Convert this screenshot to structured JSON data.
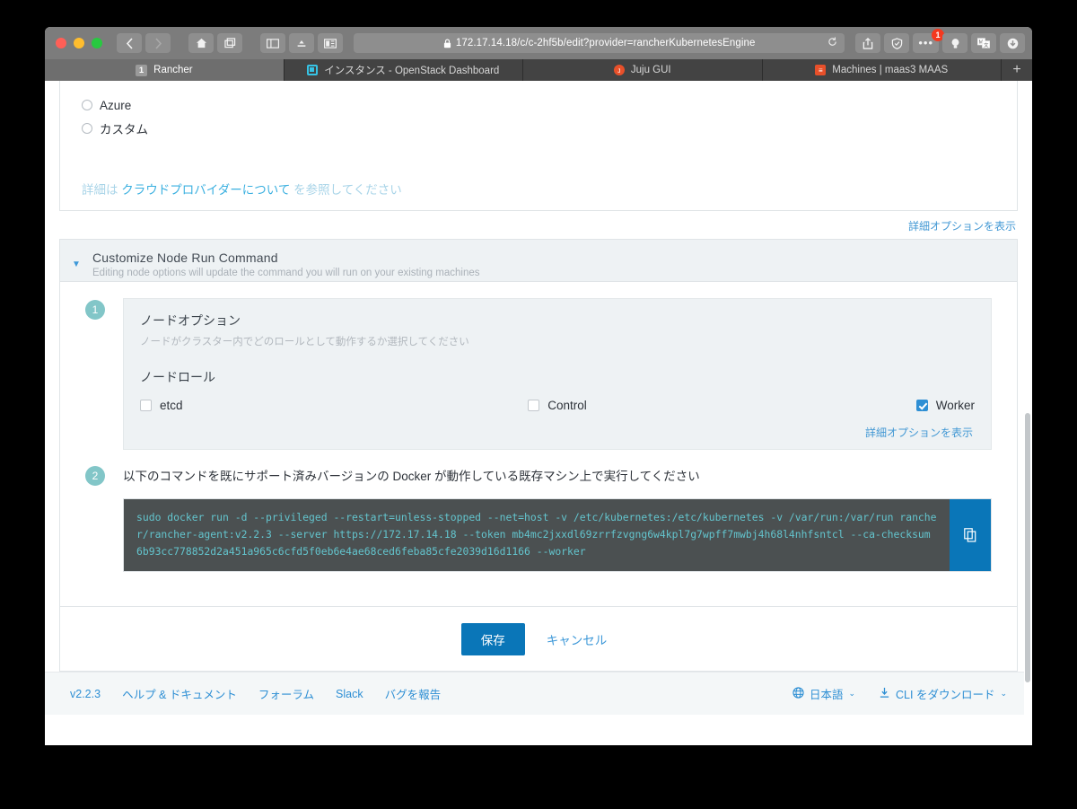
{
  "browser": {
    "url": "172.17.14.18/c/c-2hf5b/edit?provider=rancherKubernetesEngine",
    "nav": {
      "back": "‹",
      "forward": "›",
      "home": "home-icon",
      "tabs": "tabs-icon"
    },
    "extension_badge": "1",
    "tabs": [
      {
        "title": "Rancher",
        "badge": "1",
        "active": true,
        "favicon": "number-badge"
      },
      {
        "title": "インスタンス - OpenStack Dashboard",
        "active": false,
        "favicon": "openstack-icon"
      },
      {
        "title": "Juju GUI",
        "active": false,
        "favicon": "juju-icon"
      },
      {
        "title": "Machines | maas3 MAAS",
        "active": false,
        "favicon": "maas-icon"
      }
    ],
    "new_tab_label": "+"
  },
  "page": {
    "providers": [
      {
        "label": "Azure",
        "selected": false
      },
      {
        "label": "カスタム",
        "selected": false
      }
    ],
    "provider_help": {
      "prefix": "詳細は",
      "link": "クラウドプロバイダーについて",
      "suffix": "を参照してください"
    },
    "show_advanced_top": "詳細オプションを表示",
    "customize": {
      "title": "Customize Node Run Command",
      "subtitle": "Editing node options will update the command you will run on your existing machines",
      "caret": "▼"
    },
    "step1": {
      "number": "1",
      "title": "ノードオプション",
      "subtitle": "ノードがクラスター内でどのロールとして動作するか選択してください",
      "role_label": "ノードロール",
      "roles": [
        {
          "label": "etcd",
          "checked": false
        },
        {
          "label": "Control",
          "checked": false
        },
        {
          "label": "Worker",
          "checked": true
        }
      ],
      "show_advanced": "詳細オプションを表示"
    },
    "step2": {
      "number": "2",
      "label": "以下のコマンドを既にサポート済みバージョンの Docker が動作している既存マシン上で実行してください",
      "command": "sudo docker run -d --privileged --restart=unless-stopped --net=host -v /etc/kubernetes:/etc/kubernetes -v /var/run:/var/run rancher/rancher-agent:v2.2.3 --server https://172.17.14.18 --token mb4mc2jxxdl69zrrfzvgng6w4kpl7g7wpff7mwbj4h68l4nhfsntcl --ca-checksum 6b93cc778852d2a451a965c6cfd5f0eb6e4ae68ced6feba85cfe2039d16d1166 --worker",
      "copy_icon": "copy-icon"
    },
    "actions": {
      "save": "保存",
      "cancel": "キャンセル"
    },
    "footer": {
      "version": "v2.2.3",
      "links": [
        "ヘルプ & ドキュメント",
        "フォーラム",
        "Slack",
        "バグを報告"
      ],
      "language": "日本語",
      "language_icon": "globe-icon",
      "cli_download": "CLI をダウンロード",
      "cli_icon": "download-icon",
      "caret": "⌄"
    }
  },
  "colors": {
    "accent_blue": "#0a76b8",
    "link_blue": "#2e8fd4",
    "step_teal": "#82c6c8",
    "command_bg": "#4b5051",
    "command_text": "#63c4cd"
  }
}
